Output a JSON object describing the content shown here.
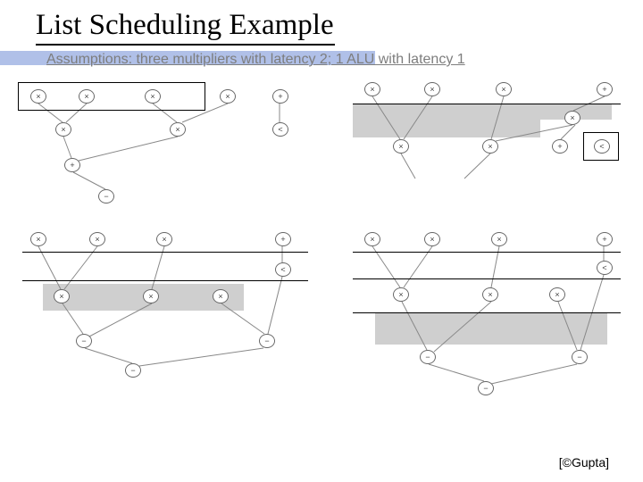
{
  "title": "List Scheduling Example",
  "subtitle": "Assumptions: three multipliers with latency 2; 1 ALU with latency 1",
  "attribution": "[©Gupta]",
  "symbols": {
    "mul": "×",
    "add": "+",
    "sub": "−",
    "lt": "<"
  },
  "quadrants": {
    "tl": {
      "row1": [
        "mul",
        "mul",
        "mul",
        "mul",
        "add"
      ],
      "row2": [
        "mul",
        "mul",
        "lt"
      ],
      "row3": [
        "add"
      ],
      "row4": [
        "sub"
      ]
    },
    "tr": {
      "row1": [
        "mul",
        "mul",
        "mul",
        "add"
      ],
      "row2l": [
        "mul"
      ],
      "row2": [
        "mul",
        "mul",
        "add",
        "lt"
      ]
    },
    "bl": {
      "row1": [
        "mul",
        "mul",
        "mul",
        "add"
      ],
      "row2l": [
        "lt"
      ],
      "row2": [
        "mul",
        "mul",
        "mul"
      ],
      "row3": [
        "sub",
        "sub"
      ],
      "row4": [
        "sub"
      ]
    },
    "br": {
      "row1": [
        "mul",
        "mul",
        "mul",
        "add"
      ],
      "row2l": [
        "lt"
      ],
      "row2": [
        "mul",
        "mul",
        "mul"
      ],
      "row3": [
        "sub",
        "sub"
      ],
      "row4": [
        "sub"
      ]
    }
  }
}
